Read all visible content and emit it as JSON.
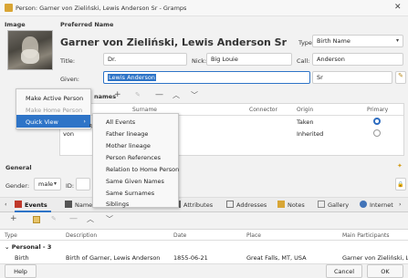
{
  "window": {
    "title": "Person: Garner von Zieliński, Lewis Anderson Sr - Gramps"
  },
  "image_section": {
    "label": "Image"
  },
  "preferred_name": {
    "label": "Preferred Name",
    "display": "Garner von Zieliński, Lewis Anderson Sr",
    "type_label": "Type:",
    "type_value": "Birth Name",
    "title_label": "Title:",
    "title_value": "Dr.",
    "nick_label": "Nick:",
    "nick_value": "Big Louie",
    "call_label": "Call:",
    "call_value": "Anderson",
    "given_label": "Given:",
    "given_value": "Lewis Anderson",
    "suffix_value": "Sr"
  },
  "surnames": {
    "label": "Multiple Surnames",
    "label_visible": "names",
    "columns": [
      "Surname",
      "Connector",
      "Origin",
      "Primary"
    ],
    "rows": [
      {
        "prefix": "",
        "origin": "Taken",
        "primary": true
      },
      {
        "prefix": "von",
        "origin": "Inherited",
        "primary": false
      }
    ]
  },
  "context_menu": {
    "items": [
      {
        "label": "Make Active Person",
        "disabled": false
      },
      {
        "label": "Make Home Person",
        "disabled": true
      },
      {
        "label": "Quick View",
        "disabled": false,
        "selected": true,
        "submenu": true
      }
    ]
  },
  "quick_view_submenu": {
    "items": [
      "All Events",
      "Father lineage",
      "Mother lineage",
      "Person References",
      "Relation to Home Person",
      "Same Given Names",
      "Same Surnames",
      "Siblings"
    ]
  },
  "general": {
    "label": "General",
    "gender_label": "Gender:",
    "gender_value": "male",
    "id_label": "ID:",
    "tags_label": "o"
  },
  "tabs": [
    {
      "label": "Events",
      "active": true
    },
    {
      "label": "Names"
    },
    {
      "label": "Attributes"
    },
    {
      "label": "Addresses"
    },
    {
      "label": "Notes"
    },
    {
      "label": "Gallery"
    },
    {
      "label": "Internet"
    }
  ],
  "events": {
    "columns": [
      "Type",
      "Description",
      "Date",
      "Place",
      "Main Participants"
    ],
    "group_label": "Personal - 3",
    "rows": [
      {
        "type": "Birth",
        "description": "Birth of Garner, Lewis Anderson",
        "date": "1855-06-21",
        "place": "Great Falls, MT, USA",
        "participants": "Garner von Zieliński, L"
      }
    ]
  },
  "buttons": {
    "help": "Help",
    "cancel": "Cancel",
    "ok": "OK"
  },
  "colors": {
    "accent": "#2e74c7",
    "selection_text": "#ffffff"
  }
}
